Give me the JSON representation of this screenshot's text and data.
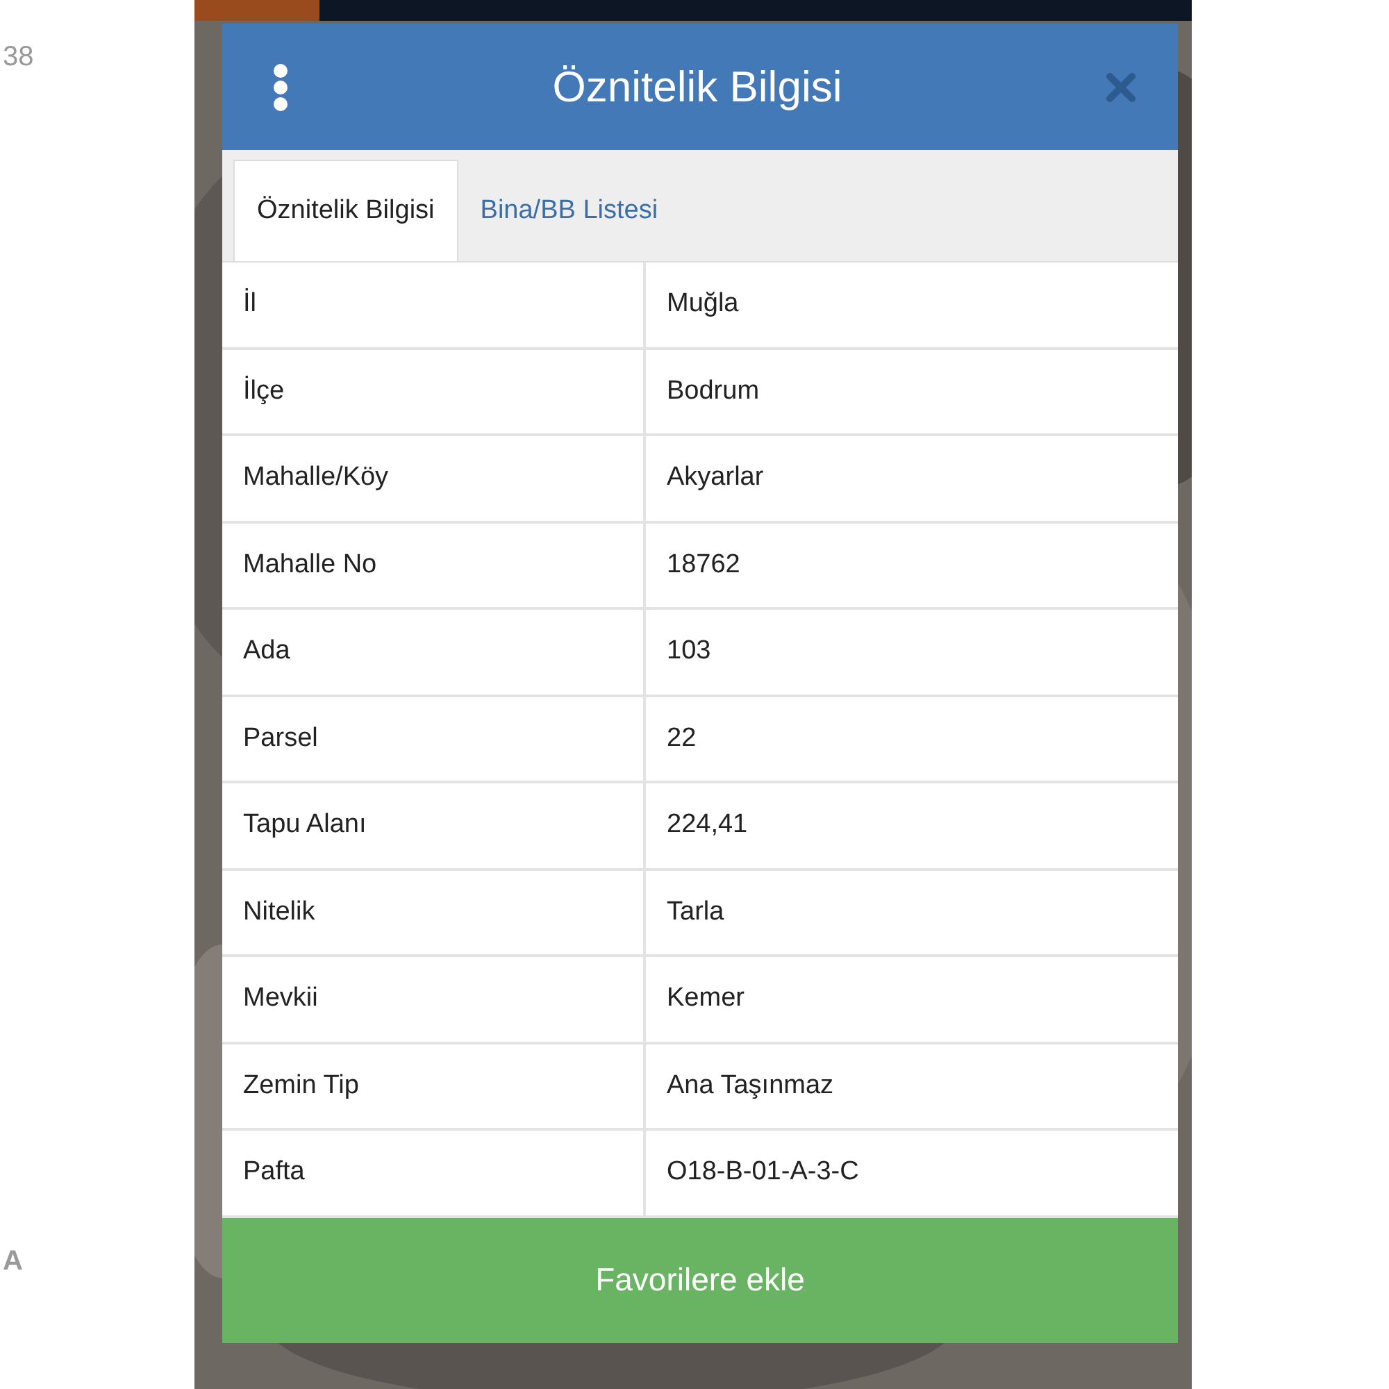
{
  "side_fragments": [
    "38",
    "A"
  ],
  "dialog": {
    "title": "Öznitelik Bilgisi",
    "tabs": [
      {
        "label": "Öznitelik Bilgisi",
        "selected": true
      },
      {
        "label": "Bina/BB Listesi",
        "selected": false
      }
    ],
    "rows": [
      {
        "label": "İl",
        "value": "Muğla"
      },
      {
        "label": "İlçe",
        "value": "Bodrum"
      },
      {
        "label": "Mahalle/Köy",
        "value": "Akyarlar"
      },
      {
        "label": "Mahalle No",
        "value": "18762"
      },
      {
        "label": "Ada",
        "value": "103"
      },
      {
        "label": "Parsel",
        "value": "22"
      },
      {
        "label": "Tapu Alanı",
        "value": "224,41"
      },
      {
        "label": "Nitelik",
        "value": "Tarla"
      },
      {
        "label": "Mevkii",
        "value": "Kemer"
      },
      {
        "label": "Zemin Tip",
        "value": "Ana Taşınmaz"
      },
      {
        "label": "Pafta",
        "value": "O18-B-01-A-3-C"
      }
    ],
    "button": "Favorilere ekle"
  }
}
